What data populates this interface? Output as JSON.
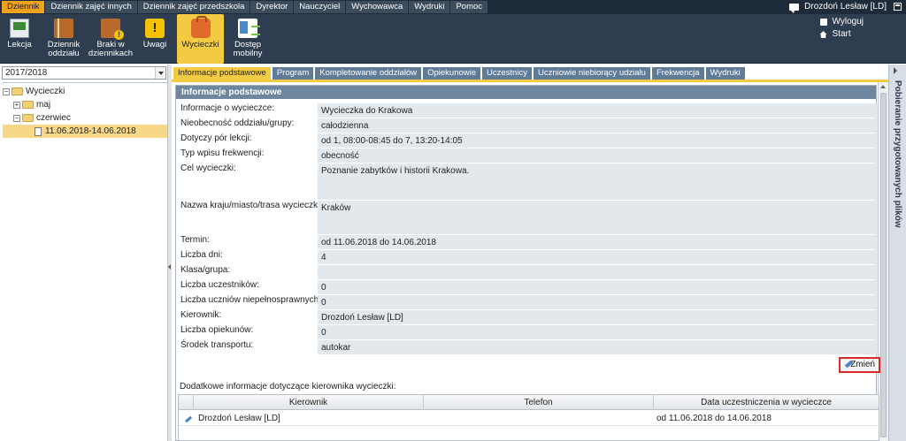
{
  "top_menu": {
    "items": [
      "Dziennik",
      "Dziennik zajęć innych",
      "Dziennik zajęć przedszkola",
      "Dyrektor",
      "Nauczyciel",
      "Wychowawca",
      "Wydruki",
      "Pomoc"
    ],
    "active_index": 0,
    "user_name": "Drozdoń Lesław [LD]"
  },
  "toolbar": {
    "items": [
      {
        "label": "Lekcja",
        "icon": "lesson-board-icon"
      },
      {
        "label": "Dziennik oddziału",
        "icon": "journal-book-icon"
      },
      {
        "label": "Braki w dziennikach",
        "icon": "missing-entries-icon"
      },
      {
        "label": "Uwagi",
        "icon": "remarks-icon"
      },
      {
        "label": "Wycieczki",
        "icon": "backpack-icon"
      },
      {
        "label": "Dostęp mobilny",
        "icon": "mobile-phone-icon"
      }
    ],
    "active_index": 4,
    "logout_label": "Wyloguj",
    "start_label": "Start"
  },
  "left_panel": {
    "year": "2017/2018",
    "tree": {
      "root": "Wycieczki",
      "month1": "maj",
      "month2": "czerwiec",
      "trip": "11.06.2018-14.06.2018"
    }
  },
  "tabs": {
    "items": [
      "Informacje podstawowe",
      "Program",
      "Kompletowanie oddziałów",
      "Opiekunowie",
      "Uczestnicy",
      "Uczniowie niebiorący udziału",
      "Frekwencja",
      "Wydruki"
    ],
    "active_index": 0
  },
  "panel": {
    "title": "Informacje podstawowe",
    "fields": [
      {
        "label": "Informacje o wycieczce:",
        "value": "Wycieczka do Krakowa"
      },
      {
        "label": "Nieobecność oddziału/grupy:",
        "value": "całodzienna"
      },
      {
        "label": "Dotyczy pór lekcji:",
        "value": "od 1, 08:00-08:45 do 7, 13:20-14:05"
      },
      {
        "label": "Typ wpisu frekwencji:",
        "value": "obecność"
      },
      {
        "label": "Cel wycieczki:",
        "value": "Poznanie zabytków i historii Krakowa."
      },
      {
        "label": "Nazwa kraju/miasto/trasa wycieczki:",
        "value": "Kraków"
      },
      {
        "label": "Termin:",
        "value": "od 11.06.2018 do 14.06.2018"
      },
      {
        "label": "Liczba dni:",
        "value": "4"
      },
      {
        "label": "Klasa/grupa:",
        "value": ""
      },
      {
        "label": "Liczba uczestników:",
        "value": "0"
      },
      {
        "label": "Liczba uczniów niepełnosprawnych:",
        "value": "0"
      },
      {
        "label": "Kierownik:",
        "value": "Drozdoń Lesław [LD]"
      },
      {
        "label": "Liczba opiekunów:",
        "value": "0"
      },
      {
        "label": "Środek transportu:",
        "value": "autokar"
      }
    ],
    "change_button": "Zmień"
  },
  "leader_section": {
    "title": "Dodatkowe informacje dotyczące kierownika wycieczki:",
    "columns": [
      "Kierownik",
      "Telefon",
      "Data uczestniczenia w wycieczce"
    ],
    "rows": [
      {
        "kierownik": "Drozdoń Lesław [LD]",
        "telefon": "",
        "data": "od 11.06.2018 do 14.06.2018"
      }
    ]
  },
  "right_panel": {
    "label": "Pobieranie przygotowanych plików"
  }
}
